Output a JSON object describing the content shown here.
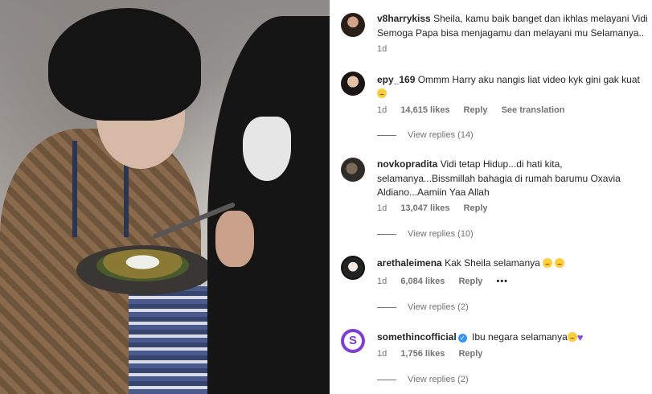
{
  "comments": [
    {
      "username": "v8harrykiss",
      "avatar": "profile-photo",
      "text_line1": "Sheila, kamu baik banget dan ikhlas melayani Vidi",
      "text_line2": "Semoga Papa bisa menjagamu dan melayani mu Selamanya..",
      "time": "1d"
    },
    {
      "username": "epy_169",
      "avatar": "profile-photo",
      "text_line1": "Ommm Harry aku nangis liat video kyk gini gak kuat",
      "emoji_line2": "sad-face-emoji",
      "time": "1d",
      "likes": "14,615 likes",
      "reply": "Reply",
      "translate": "See translation",
      "view_replies": "View replies (14)"
    },
    {
      "username": "novkopradita",
      "avatar": "profile-photo",
      "text_line1": "Vidi tetap Hidup...di hati kita,",
      "text_line2": "selamanya...Bissmillah bahagia di rumah barumu Oxavia",
      "text_line3": "Aldiano...Aamiin Yaa Allah",
      "time": "1d",
      "likes": "13,047 likes",
      "reply": "Reply",
      "view_replies": "View replies (10)"
    },
    {
      "username": "arethaleimena",
      "avatar": "profile-photo",
      "text_line1": "Kak Sheila selamanya",
      "emojis": [
        "sad-face-emoji",
        "sad-face-emoji"
      ],
      "time": "1d",
      "likes": "6,084 likes",
      "reply": "Reply",
      "more": "•••",
      "view_replies": "View replies (2)"
    },
    {
      "username": "somethincofficial",
      "verified": true,
      "avatar": "brand-logo",
      "avatar_letter": "S",
      "text_line1": "Ibu negara selamanya",
      "emojis": [
        "sad-face-emoji",
        "purple-heart-emoji"
      ],
      "time": "1d",
      "likes": "1,756 likes",
      "reply": "Reply",
      "view_replies": "View replies (2)"
    }
  ],
  "colors": {
    "text": "#262626",
    "meta": "#737373",
    "verified": "#3797f0",
    "brand_avatar": "#7d3fd8"
  }
}
